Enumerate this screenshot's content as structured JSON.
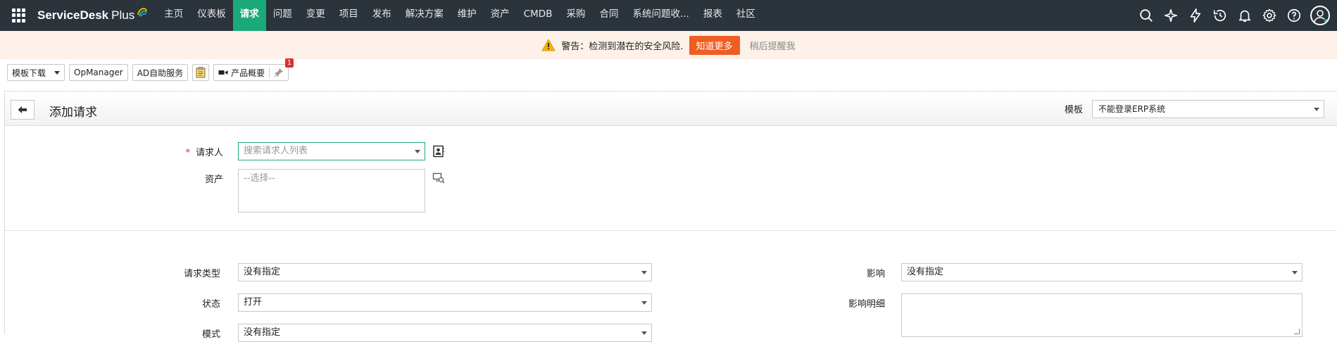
{
  "nav": {
    "brand": "ServiceDesk",
    "brand_plus": "Plus",
    "items": [
      {
        "label": "主页"
      },
      {
        "label": "仪表板"
      },
      {
        "label": "请求",
        "active": true
      },
      {
        "label": "问题"
      },
      {
        "label": "变更"
      },
      {
        "label": "项目"
      },
      {
        "label": "发布"
      },
      {
        "label": "解决方案"
      },
      {
        "label": "维护"
      },
      {
        "label": "资产"
      },
      {
        "label": "CMDB"
      },
      {
        "label": "采购"
      },
      {
        "label": "合同"
      },
      {
        "label": "系统问题收..."
      },
      {
        "label": "报表"
      },
      {
        "label": "社区"
      }
    ],
    "right_icons": [
      "search-icon",
      "sparkle-icon",
      "lightning-icon",
      "history-icon",
      "bell-icon",
      "gear-icon",
      "help-icon",
      "avatar"
    ]
  },
  "warning": {
    "text": "警告：检测到潜在的安全风险.",
    "learn_more": "知道更多",
    "remind_later": "稍后提醒我"
  },
  "toolbar": {
    "template_download": "模板下载",
    "opmanager": "OpManager",
    "ad_self_service": "AD自助服务",
    "product_overview": "产品概要",
    "badge_count": "1"
  },
  "form": {
    "title": "添加请求",
    "template_label": "模板",
    "template_value": "不能登录ERP系统",
    "requester_label": "请求人",
    "requester_placeholder": "搜索请求人列表",
    "asset_label": "资产",
    "asset_placeholder": "--选择--",
    "request_type_label": "请求类型",
    "request_type_value": "没有指定",
    "status_label": "状态",
    "status_value": "打开",
    "mode_label": "模式",
    "mode_value": "没有指定",
    "impact_label": "影响",
    "impact_value": "没有指定",
    "impact_details_label": "影响明细"
  },
  "colors": {
    "nav_bg": "#2b333b",
    "nav_active": "#1aaa7a",
    "warning_bg": "#fdf1e9",
    "warning_button": "#f05d23",
    "badge": "#e02d2d"
  }
}
